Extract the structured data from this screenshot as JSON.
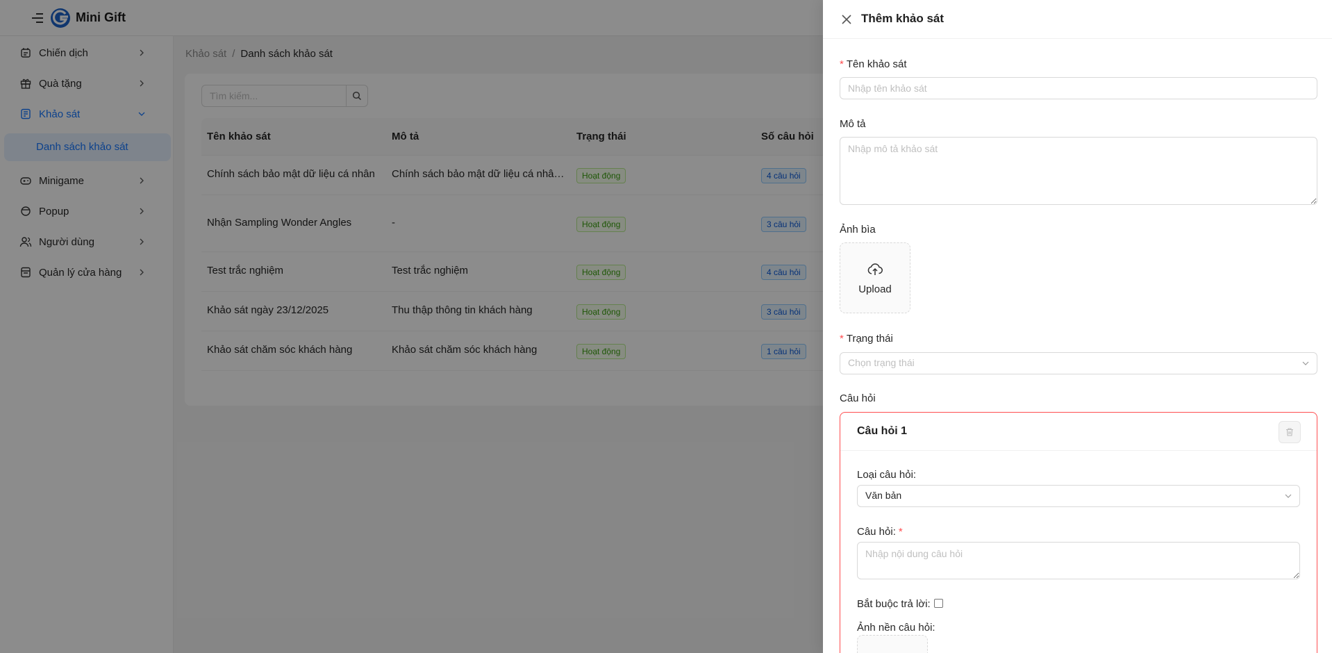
{
  "app": {
    "brand": "Mini Gift"
  },
  "sidebar": {
    "items": [
      {
        "label": "Chiến dịch",
        "icon": "campaign-icon"
      },
      {
        "label": "Quà tặng",
        "icon": "gift-icon"
      },
      {
        "label": "Khảo sát",
        "icon": "survey-icon",
        "expanded": true
      },
      {
        "label": "Minigame",
        "icon": "gamepad-icon"
      },
      {
        "label": "Popup",
        "icon": "popup-icon"
      },
      {
        "label": "Người dùng",
        "icon": "users-icon"
      },
      {
        "label": "Quản lý cửa hàng",
        "icon": "store-icon"
      }
    ],
    "sub_active": "Danh sách khảo sát"
  },
  "breadcrumb": {
    "parent": "Khảo sát",
    "separator": "/",
    "current": "Danh sách khảo sát"
  },
  "search": {
    "placeholder": "Tìm kiếm..."
  },
  "table": {
    "columns": [
      "Tên khảo sát",
      "Mô tả",
      "Trạng thái",
      "Số câu hỏi"
    ],
    "rows": [
      {
        "name": "Chính sách bảo mật dữ liệu cá nhân",
        "desc": "Chính sách bảo mật dữ liệu cá nhân k...",
        "status": "Hoạt động",
        "count": "4 câu hỏi"
      },
      {
        "name": "Nhận Sampling Wonder Angles",
        "desc": "-",
        "status": "Hoạt động",
        "count": "3 câu hỏi"
      },
      {
        "name": "Test trắc nghiệm",
        "desc": "Test trắc nghiệm",
        "status": "Hoạt động",
        "count": "4 câu hỏi"
      },
      {
        "name": "Khảo sát ngày 23/12/2025",
        "desc": "Thu thập thông tin khách hàng",
        "status": "Hoạt động",
        "count": "3 câu hỏi"
      },
      {
        "name": "Khảo sát chăm sóc khách hàng",
        "desc": "Khảo sát chăm sóc khách hàng",
        "status": "Hoạt động",
        "count": "1 câu hỏi"
      }
    ]
  },
  "drawer": {
    "title": "Thêm khảo sát",
    "name_label": "Tên khảo sát",
    "name_placeholder": "Nhập tên khảo sát",
    "desc_label": "Mô tả",
    "desc_placeholder": "Nhập mô tả khảo sát",
    "cover_label": "Ảnh bìa",
    "upload_label": "Upload",
    "status_label": "Trạng thái",
    "status_placeholder": "Chọn trạng thái",
    "questions_label": "Câu hỏi",
    "question": {
      "title": "Câu hỏi 1",
      "type_label": "Loại câu hỏi:",
      "type_value": "Văn bản",
      "content_label": "Câu hỏi:",
      "content_placeholder": "Nhập nội dung câu hỏi",
      "required_label": "Bắt buộc trả lời:",
      "bg_label": "Ảnh nền câu hỏi:"
    }
  },
  "colors": {
    "primary": "#1677ff",
    "required": "#ff4d4f",
    "error_border": "#ff4d4f"
  }
}
